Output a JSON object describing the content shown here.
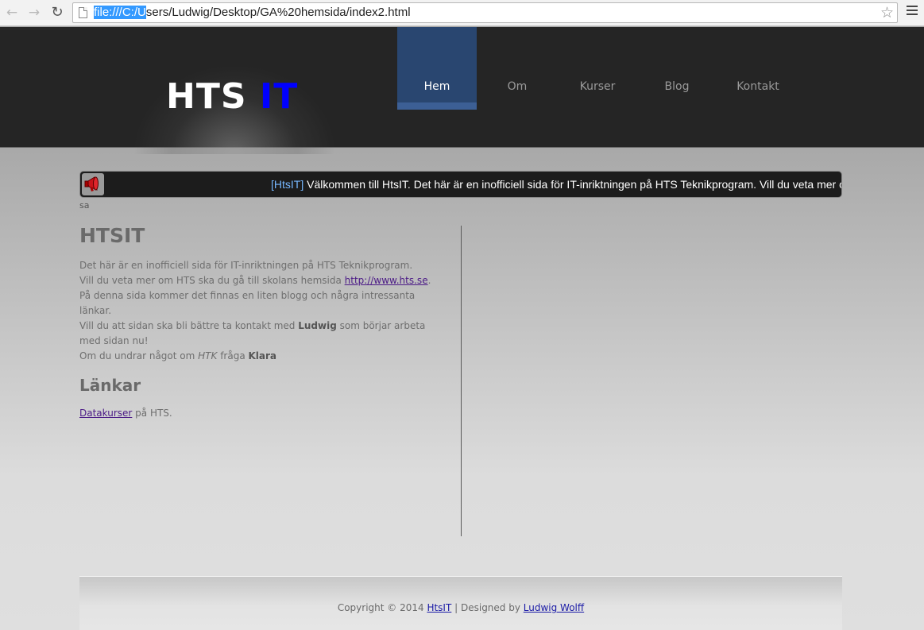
{
  "browser": {
    "url_selected": "file:///C:/U",
    "url_rest": "sers/Ludwig/Desktop/GA%20hemsida/index2.html",
    "back_icon": "arrow-left-icon",
    "forward_icon": "arrow-right-icon",
    "reload_icon": "reload-icon",
    "bookmark_icon": "star-icon",
    "menu_icon": "hamburger-icon"
  },
  "header": {
    "logo_main": "HTS ",
    "logo_accent": "IT",
    "accent_color": "#0000ff",
    "nav": [
      {
        "label": "Hem",
        "active": true
      },
      {
        "label": "Om"
      },
      {
        "label": "Kurser"
      },
      {
        "label": "Blog"
      },
      {
        "label": "Kontakt"
      }
    ]
  },
  "ticker": {
    "tag": "[HtsIT]",
    "message": " Välkommen till HtsIT. Det här är en inofficiell sida för IT-inriktningen på HTS Teknikprogram. Vill du veta mer om",
    "tail": "sa",
    "icon": "megaphone-icon"
  },
  "content": {
    "title": "HTSIT",
    "line1": "Det här är en inofficiell sida för IT-inriktningen på HTS Teknikprogram.",
    "line2_pre": "Vill du veta mer om HTS ska du gå till skolans hemsida ",
    "line2_link": "http://www.hts.se",
    "line2_post": ".",
    "line3": "På denna sida kommer det finnas en liten blogg och några intressanta länkar.",
    "line4_pre": "Vill du att sidan ska bli bättre ta kontakt med ",
    "line4_bold": "Ludwig",
    "line4_post": " som börjar arbeta med sidan nu!",
    "line5_pre": "Om du undrar något om ",
    "line5_italic": "HTK",
    "line5_mid": " fråga ",
    "line5_bold": "Klara",
    "links_title": "Länkar",
    "link_label": "Datakurser",
    "link_suffix": " på HTS."
  },
  "footer": {
    "copyright": "Copyright © 2014 ",
    "site_link": "HtsIT",
    "separator": " | Designed by ",
    "designer_link": "Ludwig Wolff"
  }
}
